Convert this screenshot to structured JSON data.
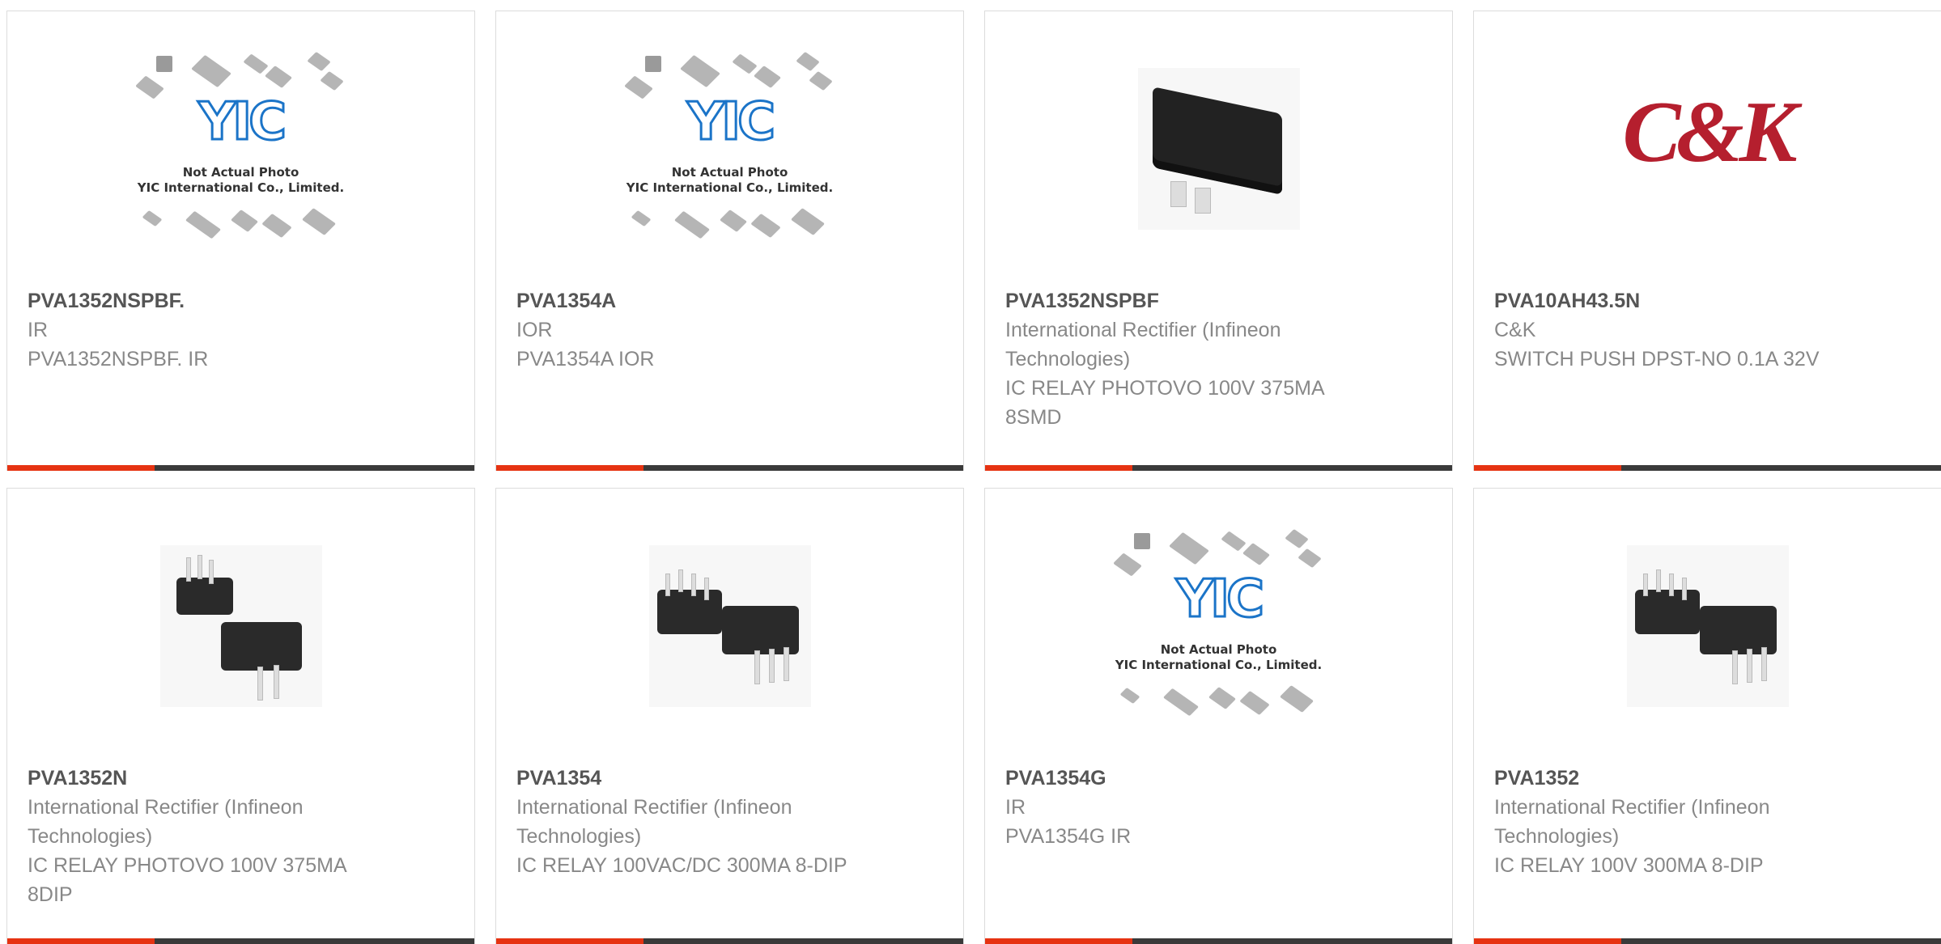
{
  "products": [
    {
      "part": "PVA1352NSPBF.",
      "mfr": "IR",
      "desc": "PVA1352NSPBF. IR",
      "image": "yic-placeholder"
    },
    {
      "part": "PVA1354A",
      "mfr": "IOR",
      "desc": "PVA1354A IOR",
      "image": "yic-placeholder"
    },
    {
      "part": "PVA1352NSPBF",
      "mfr": "International Rectifier (Infineon Technologies)",
      "desc": "IC RELAY PHOTOVO 100V 375MA 8SMD",
      "image": "smd-relay-photo"
    },
    {
      "part": "PVA10AH43.5N",
      "mfr": "C&K",
      "desc": "SWITCH PUSH DPST-NO 0.1A 32V",
      "image": "ck-logo"
    },
    {
      "part": "PVA1352N",
      "mfr": "International Rectifier (Infineon Technologies)",
      "desc": "IC RELAY PHOTOVO 100V 375MA 8DIP",
      "image": "dip-relay-photo"
    },
    {
      "part": "PVA1354",
      "mfr": "International Rectifier (Infineon Technologies)",
      "desc": "IC RELAY 100VAC/DC 300MA 8-DIP",
      "image": "dip-relay-photo"
    },
    {
      "part": "PVA1354G",
      "mfr": "IR",
      "desc": "PVA1354G IR",
      "image": "yic-placeholder"
    },
    {
      "part": "PVA1352",
      "mfr": "International Rectifier (Infineon Technologies)",
      "desc": "IC RELAY 100V 300MA 8-DIP",
      "image": "dip-relay-photo"
    }
  ],
  "placeholder": {
    "logo": "YIC",
    "line1": "Not Actual Photo",
    "line2": "YIC International Co., Limited."
  },
  "brand_logo_text": "C&K",
  "colors": {
    "accent": "#e63312",
    "bar": "#3a3a3a",
    "title": "#555555",
    "text": "#888888"
  }
}
